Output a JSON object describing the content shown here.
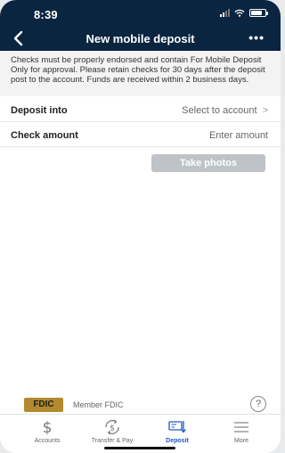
{
  "status": {
    "time": "8:39"
  },
  "nav": {
    "title": "New mobile deposit",
    "more": "•••"
  },
  "info": {
    "text": "Checks must be properly endorsed and contain For Mobile Deposit Only for approval. Please retain checks for 30 days after the deposit post to the account. Funds are received within 2 business days."
  },
  "rows": {
    "deposit_into": {
      "label": "Deposit into",
      "value": "Select to account",
      "chevron": ">"
    },
    "check_amount": {
      "label": "Check amount",
      "value": "Enter amount"
    }
  },
  "buttons": {
    "take_photos": "Take photos"
  },
  "footer": {
    "fdic_logo": "FDIC",
    "fdic_text": "Member FDIC",
    "help": "?"
  },
  "tabs": [
    {
      "label": "Accounts",
      "icon": "dollar-icon"
    },
    {
      "label": "Transfer & Pay",
      "icon": "transfer-dollar-icon"
    },
    {
      "label": "Deposit",
      "icon": "deposit-check-icon",
      "active": true
    },
    {
      "label": "More",
      "icon": "hamburger-icon"
    }
  ],
  "colors": {
    "header": "#0a2540",
    "accent": "#2157c7",
    "button_disabled": "#bfc2c6"
  }
}
